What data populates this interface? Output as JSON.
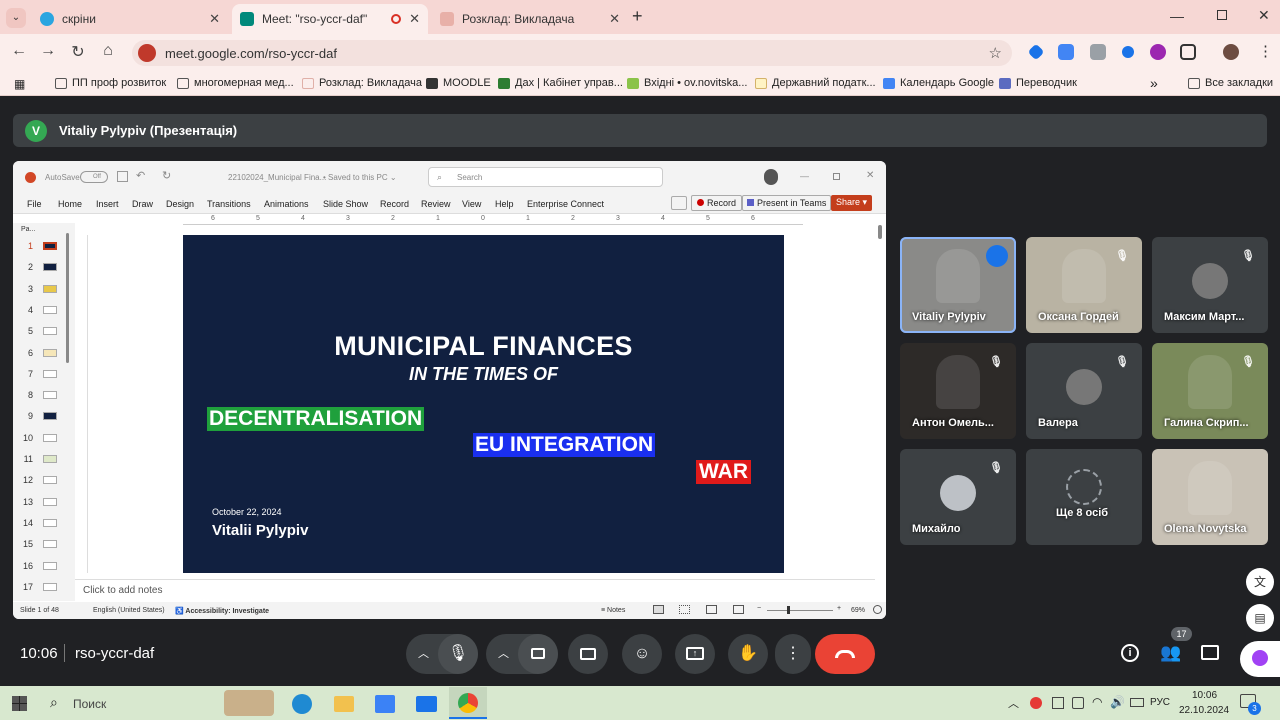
{
  "browser": {
    "tabs": [
      {
        "label": "скріни",
        "color": "#2aa5e0"
      },
      {
        "label": "Meet: \"rso-yccr-daf\"",
        "color": "#00897b"
      },
      {
        "label": "Розклад: Викладача",
        "color": "#e8b0a8"
      }
    ],
    "new_tab": "+",
    "url": "meet.google.com/rso-yccr-daf",
    "bookmarks": [
      "ПП проф розвиток",
      "многомерная мед...",
      "Розклад: Викладача",
      "MOODLE",
      "Дах | Кабінет управ...",
      "Вхідні • ov.novitska...",
      "Державний податк...",
      "Календарь Google",
      "Переводчик"
    ],
    "all_bookmarks": "Все закладки",
    "more": "»"
  },
  "presenter": {
    "initial": "V",
    "label": "Vitaliy Pylypiv (Презентація)"
  },
  "ppt": {
    "autosave": "AutoSave",
    "autosave_state": "Off",
    "filename": "22102024_Municipal Fina...",
    "saved": "• Saved to this PC ⌄",
    "search": "Search",
    "menu": [
      "File",
      "Home",
      "Insert",
      "Draw",
      "Design",
      "Transitions",
      "Animations",
      "Slide Show",
      "Record",
      "Review",
      "View",
      "Help",
      "Enterprise Connect"
    ],
    "record_btn": "Record",
    "teams_btn": "Present in Teams",
    "share_btn": "Share",
    "ruler": [
      "6",
      "5",
      "4",
      "3",
      "2",
      "1",
      "0",
      "1",
      "2",
      "3",
      "4",
      "5",
      "6"
    ],
    "pane_label": "Pa...",
    "thumb_numbers": [
      "1",
      "2",
      "3",
      "4",
      "5",
      "6",
      "7",
      "8",
      "9",
      "10",
      "11",
      "12",
      "13",
      "14",
      "15",
      "16",
      "17"
    ],
    "slide": {
      "title1": "MUNICIPAL FINANCES",
      "title2": "IN THE TIMES OF",
      "tag1": "DECENTRALISATION",
      "tag2": "EU INTEGRATION",
      "tag3": "WAR",
      "date": "October 22, 2024",
      "author": "Vitalii Pylypiv"
    },
    "notes_placeholder": "Click to add notes",
    "status": {
      "slide": "Slide 1 of 48",
      "lang": "English (United States)",
      "access": "Accessibility: Investigate",
      "notes": "Notes",
      "zoom": "69%"
    }
  },
  "participants": [
    {
      "name": "Vitaliy Pylypiv",
      "muted": false,
      "bg": "#8a8a88"
    },
    {
      "name": "Оксана Гордей",
      "muted": true,
      "bg": "#b9b3a3"
    },
    {
      "name": "Максим Март...",
      "muted": true,
      "bg": "#3c4043"
    },
    {
      "name": "Антон Омель...",
      "muted": true,
      "bg": "#2d2a28"
    },
    {
      "name": "Валера",
      "muted": true,
      "bg": "#3c4043"
    },
    {
      "name": "Галина Скрип...",
      "muted": true,
      "bg": "#7a8a5a"
    },
    {
      "name": "Михайло",
      "muted": true,
      "bg": "#3c4043"
    },
    {
      "name": "Ще 8 осіб",
      "muted": false,
      "bg": "#3c4043"
    },
    {
      "name": "Olena Novytska",
      "muted": false,
      "bg": "#c9c2b6"
    }
  ],
  "meeting": {
    "time": "10:06",
    "code": "rso-yccr-daf",
    "people_count": "17"
  },
  "taskbar": {
    "search": "Поиск",
    "lang": "РУС",
    "time": "10:06",
    "date": "22.10.2024",
    "notif": "3"
  }
}
